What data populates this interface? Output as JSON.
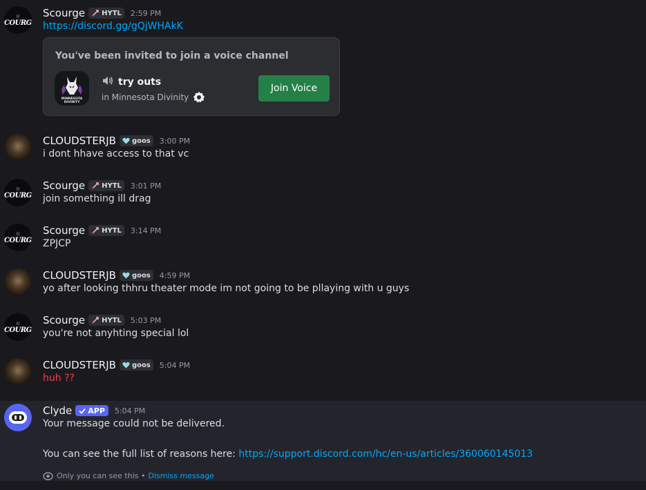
{
  "messages": [
    {
      "author": "Scourge",
      "tag": "HYTL",
      "time": "2:59 PM",
      "link": "https://discord.gg/gQjWHAkK",
      "invite": {
        "title": "You've been invited to join a voice channel",
        "channel": "try outs",
        "server": "in Minnesota Divinity",
        "guild_icon_text": "MINNESOTA DIVINITY",
        "button": "Join Voice"
      }
    },
    {
      "author": "CLOUDSTERJB",
      "tag": "goos",
      "time": "3:00 PM",
      "text": "i dont hhave access to that vc"
    },
    {
      "author": "Scourge",
      "tag": "HYTL",
      "time": "3:01 PM",
      "text": "join something ill drag"
    },
    {
      "author": "Scourge",
      "tag": "HYTL",
      "time": "3:14 PM",
      "text": "ZPJCP"
    },
    {
      "author": "CLOUDSTERJB",
      "tag": "goos",
      "time": "4:59 PM",
      "text": "yo after looking thhru theater mode im not going to be pllaying with u guys"
    },
    {
      "author": "Scourge",
      "tag": "HYTL",
      "time": "5:03 PM",
      "text": "you're not anyhting special lol"
    },
    {
      "author": "CLOUDSTERJB",
      "tag": "goos",
      "time": "5:04 PM",
      "text": "huh ??"
    },
    {
      "author": "Clyde",
      "tag": "APP",
      "time": "5:04 PM",
      "line1": "Your message could not be delivered.",
      "line2_prefix": "You can see the full list of reasons here: ",
      "line2_link": "https://support.discord.com/hc/en-us/articles/360060145013",
      "ephemeral": "Only you can see this •",
      "dismiss": "Dismiss message"
    }
  ],
  "avatars": {
    "scourge_small": "lil",
    "scourge_main": "SCOURGE"
  },
  "colors": {
    "link": "#00a8fc",
    "join": "#248046",
    "app_badge": "#5865f2",
    "error_text": "#f23f43"
  }
}
